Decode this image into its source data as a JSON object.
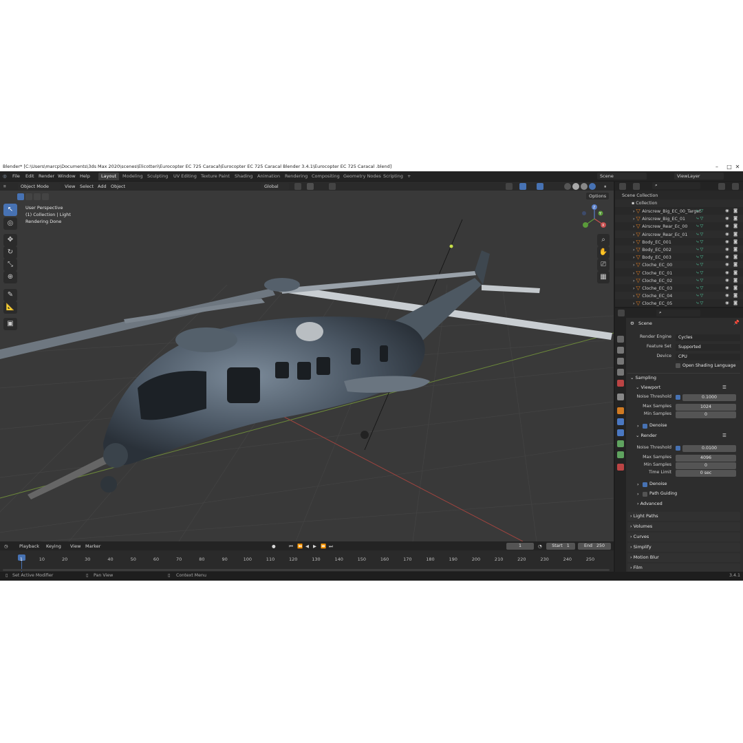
{
  "window": {
    "title": "Blender* [C:\\Users\\marcp\\Documents\\3ds Max 2020\\scenes\\Elicotteri\\Eurocopter EC 725 Caracal\\Eurocopter EC 725 Caracal Blender 3.4.1\\Eurocopter EC 725 Caracal .blend]",
    "minimize": "–",
    "maximize": "□",
    "close": "✕"
  },
  "menu": [
    "File",
    "Edit",
    "Render",
    "Window",
    "Help"
  ],
  "workspaces": [
    "Layout",
    "Modeling",
    "Sculpting",
    "UV Editing",
    "Texture Paint",
    "Shading",
    "Animation",
    "Rendering",
    "Compositing",
    "Geometry Nodes",
    "Scripting"
  ],
  "workspace_add": "+",
  "scene_name": "Scene",
  "viewlayer_name": "ViewLayer",
  "viewport": {
    "mode": "Object Mode",
    "view_menu": [
      "View",
      "Select",
      "Add",
      "Object"
    ],
    "transform": "Global",
    "options": "Options",
    "info_line1": "User Perspective",
    "info_line2": "(1) Collection | Light",
    "info_line3": "Rendering Done",
    "gizmo": {
      "z": "Z",
      "y": "Y",
      "x": "X"
    }
  },
  "outliner": {
    "root": "Scene Collection",
    "collection": "Collection",
    "items": [
      "Airscrew_Big_EC_00_Target",
      "Airscrew_Big_EC_01",
      "Airscrew_Rear_Ec_00",
      "Airscrew_Rear_Ec_01",
      "Body_EC_001",
      "Body_EC_002",
      "Body_EC_003",
      "Cloche_EC_00",
      "Cloche_EC_01",
      "Cloche_EC_02",
      "Cloche_EC_03",
      "Cloche_EC_04",
      "Cloche_EC_05"
    ]
  },
  "properties": {
    "context": "Scene",
    "render_engine_label": "Render Engine",
    "render_engine": "Cycles",
    "feature_set_label": "Feature Set",
    "feature_set": "Supported",
    "device_label": "Device",
    "device": "CPU",
    "osl_label": "Open Shading Language",
    "sampling": "Sampling",
    "viewport_sec": "Viewport",
    "noise_threshold_label": "Noise Threshold",
    "vp_noise_threshold": "0.1000",
    "max_samples_label": "Max Samples",
    "vp_max_samples": "1024",
    "min_samples_label": "Min Samples",
    "vp_min_samples": "0",
    "denoise_label": "Denoise",
    "render_sec": "Render",
    "r_noise_threshold": "0.0100",
    "r_max_samples": "4096",
    "r_min_samples": "0",
    "time_limit_label": "Time Limit",
    "r_time_limit": "0 sec",
    "path_guiding": "Path Guiding",
    "advanced": "Advanced",
    "panels": [
      "Light Paths",
      "Volumes",
      "Curves",
      "Simplify",
      "Motion Blur",
      "Film"
    ]
  },
  "timeline": {
    "menu": [
      "Playback",
      "Keying",
      "View",
      "Marker"
    ],
    "current_frame": "1",
    "start_label": "Start",
    "start": "1",
    "end_label": "End",
    "end": "250",
    "ticks": [
      "1",
      "10",
      "20",
      "30",
      "40",
      "50",
      "60",
      "70",
      "80",
      "90",
      "100",
      "110",
      "120",
      "130",
      "140",
      "150",
      "160",
      "170",
      "180",
      "190",
      "200",
      "210",
      "220",
      "230",
      "240",
      "250"
    ]
  },
  "status": {
    "left": "Set Active Modifier",
    "mid": "Pan View",
    "right": "Context Menu",
    "version": "3.4.1"
  },
  "colors": {
    "accent": "#4772b3",
    "viewport_bg": "#393939",
    "object_orange": "#e07a1f",
    "green_data": "#4fc29a"
  }
}
